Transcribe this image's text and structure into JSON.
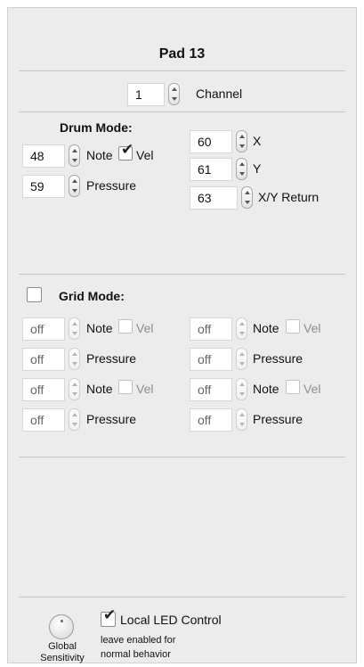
{
  "pad": {
    "title": "Pad 13"
  },
  "channel": {
    "value": "1",
    "label": "Channel"
  },
  "drum_mode": {
    "heading": "Drum Mode:",
    "note_value": "48",
    "note_label": "Note",
    "vel_label": "Vel",
    "vel_checked": true,
    "pressure_value": "59",
    "pressure_label": "Pressure",
    "x_value": "60",
    "x_label": "X",
    "y_value": "61",
    "y_label": "Y",
    "xy_return_value": "63",
    "xy_return_label": "X/Y Return"
  },
  "grid_mode": {
    "heading": "Grid Mode:",
    "enabled": false,
    "rows": [
      {
        "left_value": "off",
        "left_label": "Note",
        "left_vel": "Vel",
        "right_value": "off",
        "right_label": "Note",
        "right_vel": "Vel"
      },
      {
        "left_value": "off",
        "left_label": "Pressure",
        "right_value": "off",
        "right_label": "Pressure"
      },
      {
        "left_value": "off",
        "left_label": "Note",
        "left_vel": "Vel",
        "right_value": "off",
        "right_label": "Note",
        "right_vel": "Vel"
      },
      {
        "left_value": "off",
        "left_label": "Pressure",
        "right_value": "off",
        "right_label": "Pressure"
      }
    ]
  },
  "footer": {
    "sensitivity_line1": "Global",
    "sensitivity_line2": "Sensitivity",
    "local_led_label": "Local LED Control",
    "local_led_checked": true,
    "hint_line1": "leave enabled for",
    "hint_line2": "normal behavior"
  }
}
